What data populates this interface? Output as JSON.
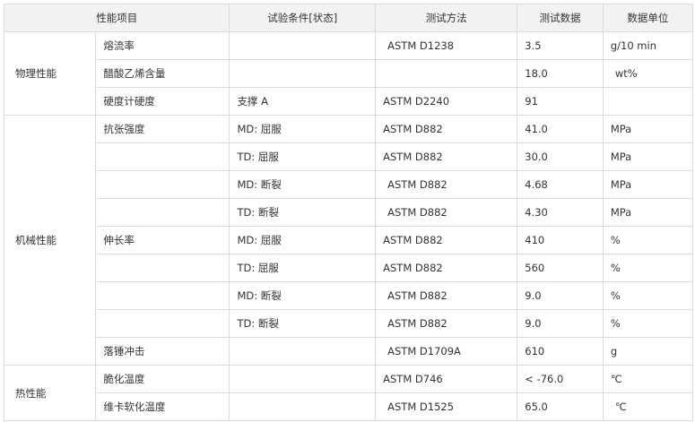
{
  "table": {
    "headers": [
      "性能项目",
      "试验条件[状态]",
      "测试方法",
      "测试数据",
      "数据单位"
    ],
    "categories": {
      "physical": "物理性能",
      "mechanical": "机械性能",
      "thermal": "热性能"
    },
    "rows": [
      {
        "property": "熔流率",
        "condition": "",
        "method": "ASTM D1238",
        "value": "3.5",
        "unit": "g/10 min"
      },
      {
        "property": "醋酸乙烯含量",
        "condition": "",
        "method": "",
        "value": "18.0",
        "unit": "wt%"
      },
      {
        "property": "硬度计硬度",
        "condition": "支撑 A",
        "method": "ASTM D2240",
        "value": "91",
        "unit": ""
      },
      {
        "property": "抗张强度",
        "condition": "MD: 屈服",
        "method": "ASTM D882",
        "value": "41.0",
        "unit": "MPa"
      },
      {
        "property": "",
        "condition": "TD: 屈服",
        "method": "ASTM D882",
        "value": "30.0",
        "unit": "MPa"
      },
      {
        "property": "",
        "condition": "MD: 断裂",
        "method": "ASTM D882",
        "value": "4.68",
        "unit": "MPa"
      },
      {
        "property": "",
        "condition": "TD: 断裂",
        "method": "ASTM D882",
        "value": "4.30",
        "unit": "MPa"
      },
      {
        "property": "伸长率",
        "condition": "MD: 屈服",
        "method": "ASTM D882",
        "value": "410",
        "unit": "%"
      },
      {
        "property": "",
        "condition": "TD: 屈服",
        "method": "ASTM D882",
        "value": "560",
        "unit": "%"
      },
      {
        "property": "",
        "condition": "MD: 断裂",
        "method": "ASTM D882",
        "value": "9.0",
        "unit": "%"
      },
      {
        "property": "",
        "condition": "TD: 断裂",
        "method": "ASTM D882",
        "value": "9.0",
        "unit": "%"
      },
      {
        "property": "落锤冲击",
        "condition": "",
        "method": "ASTM D1709A",
        "value": "610",
        "unit": "g"
      },
      {
        "property": "脆化温度",
        "condition": "",
        "method": "ASTM D746",
        "value": "< -76.0",
        "unit": "℃"
      },
      {
        "property": "维卡软化温度",
        "condition": "",
        "method": "ASTM D1525",
        "value": "65.0",
        "unit": "℃"
      }
    ]
  }
}
